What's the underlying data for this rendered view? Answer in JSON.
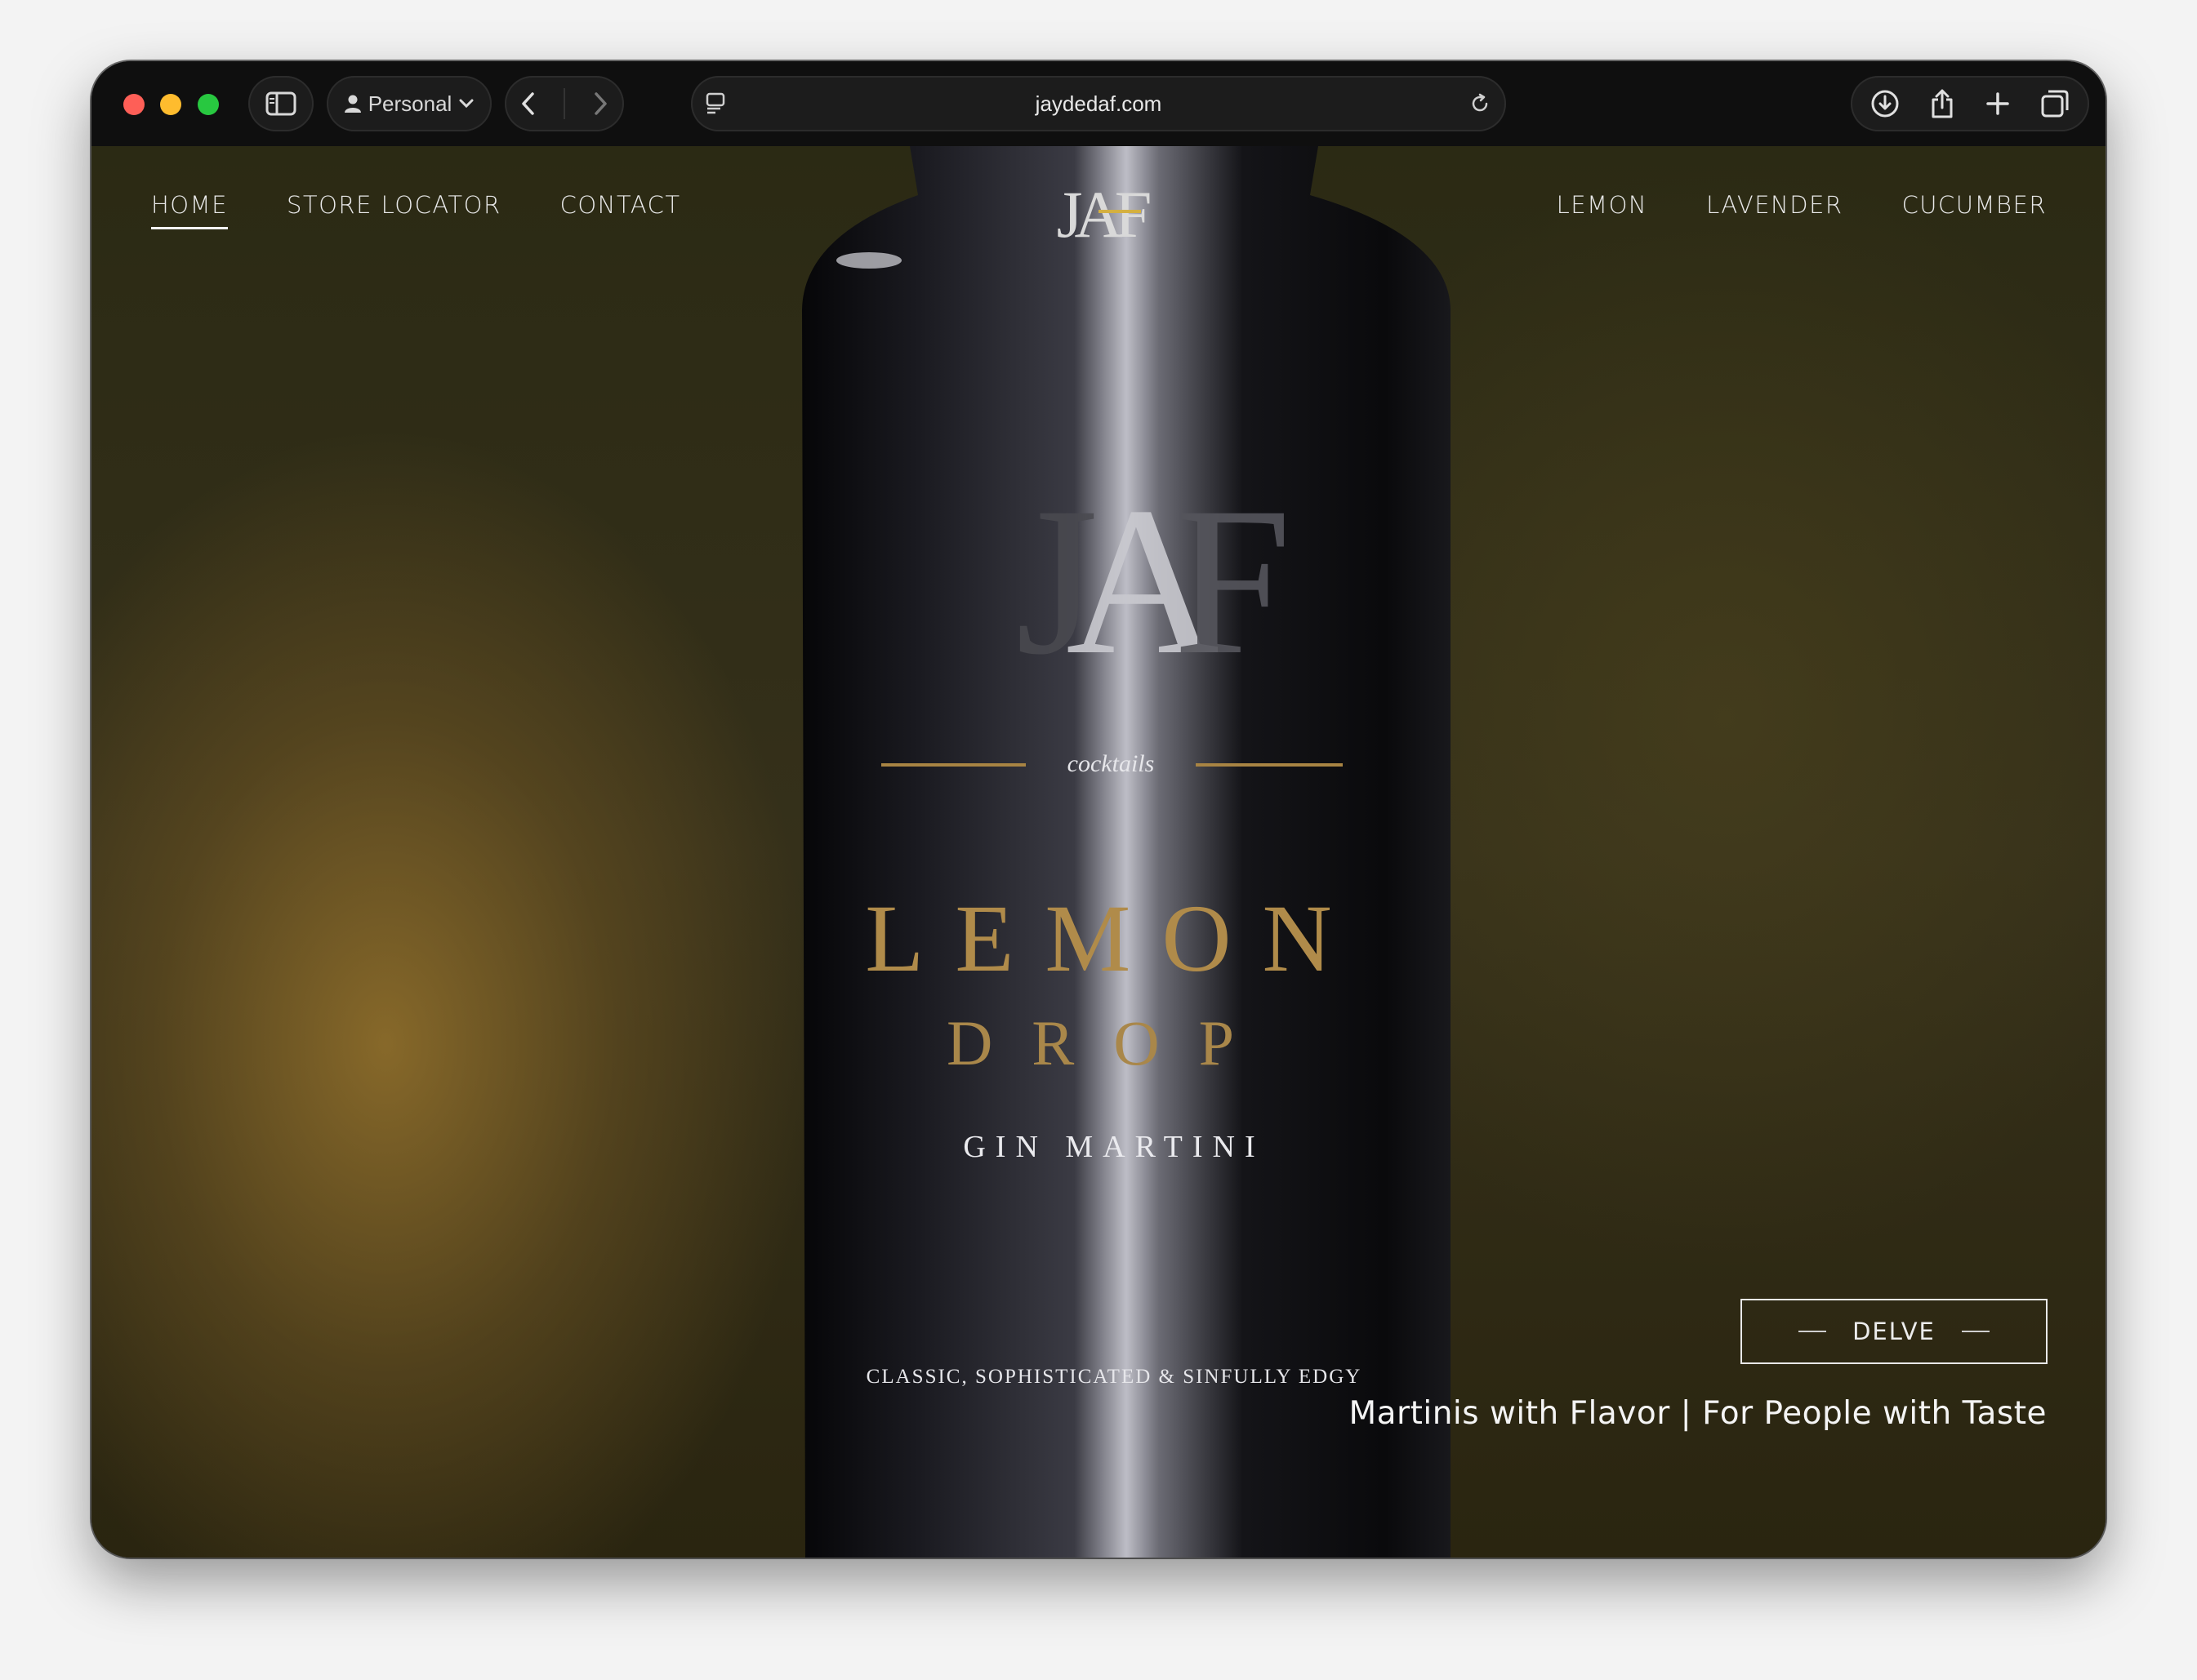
{
  "browser": {
    "profile_label": "Personal",
    "url": "jaydedaf.com",
    "icons": [
      "sidebar-icon",
      "person-icon",
      "chevron-down-icon",
      "back-icon",
      "forward-icon",
      "page-icon",
      "reload-icon",
      "download-icon",
      "share-icon",
      "plus-icon",
      "tabs-icon"
    ]
  },
  "site": {
    "nav_left": [
      "HOME",
      "STORE LOCATOR",
      "CONTACT"
    ],
    "nav_right": [
      "LEMON",
      "LAVENDER",
      "CUCUMBER"
    ],
    "logo_text": "JAF",
    "hero_cta": "DELVE",
    "tagline": "Martinis with Flavor | For People with Taste",
    "bottle_label": {
      "brand": "JAF",
      "sub": "cocktails",
      "name_line1": "LEMON",
      "name_line2": "DROP",
      "type": "GIN MARTINI",
      "slogan": "CLASSIC, SOPHISTICATED & SINFULLY EDGY"
    },
    "colors": {
      "accent_gold": "#b8893c",
      "text": "#e8e8e8"
    }
  }
}
